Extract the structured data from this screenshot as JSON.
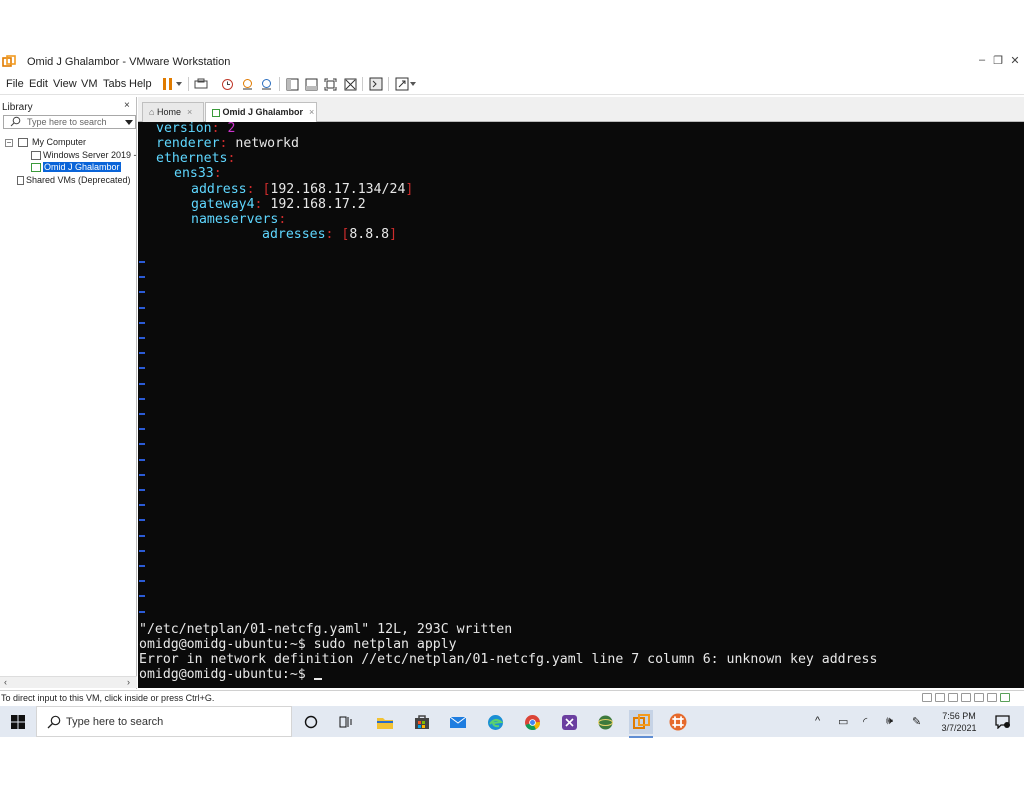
{
  "window": {
    "title": "Omid J Ghalambor - VMware Workstation",
    "minimize": "–",
    "restore": "❐",
    "close": "✕"
  },
  "menu": {
    "file": "File",
    "edit": "Edit",
    "view": "View",
    "vm": "VM",
    "tabs": "Tabs",
    "help": "Help"
  },
  "library": {
    "header": "Library",
    "close": "×",
    "search_placeholder": "Type here to search",
    "tree": {
      "my_computer": "My Computer",
      "windows_server": "Windows Server 2019 -",
      "omid_vm": "Omid J Ghalambor",
      "shared_vms": "Shared VMs (Deprecated)"
    },
    "scroll_left": "‹",
    "scroll_right": "›"
  },
  "tabs": [
    {
      "label": "Home",
      "close": "×"
    },
    {
      "label": "Omid J Ghalambor",
      "close": "×"
    }
  ],
  "terminal": {
    "yaml": {
      "version_key": "version",
      "version_val": "2",
      "renderer_key": "renderer",
      "renderer_val": "networkd",
      "ethernets_key": "ethernets",
      "iface_key": "ens33",
      "address_key": "address",
      "address_val": "192.168.17.134/24",
      "gateway_key": "gateway4",
      "gateway_val": "192.168.17.2",
      "nameservers_key": "nameservers",
      "adresses_key": "adresses",
      "adresses_val": "8.8.8"
    },
    "output": {
      "written": "\"/etc/netplan/01-netcfg.yaml\" 12L, 293C written",
      "prompt1": "omidg@omidg-ubuntu:~$ sudo netplan apply",
      "error": "Error in network definition //etc/netplan/01-netcfg.yaml line 7 column 6: unknown key address",
      "prompt2": "omidg@omidg-ubuntu:~$ "
    }
  },
  "status": {
    "text": "To direct input to this VM, click inside or press Ctrl+G."
  },
  "taskbar": {
    "search_placeholder": "Type here to search",
    "time": "7:56 PM",
    "date": "3/7/2021"
  },
  "colors": {
    "terminal_bg": "#0a0a0a",
    "yaml_key": "#5fd7ff",
    "yaml_punct": "#cc2c2c",
    "yaml_number": "#cc33cc",
    "vim_tilde": "#2b5bd7",
    "selection": "#0a64d8"
  }
}
